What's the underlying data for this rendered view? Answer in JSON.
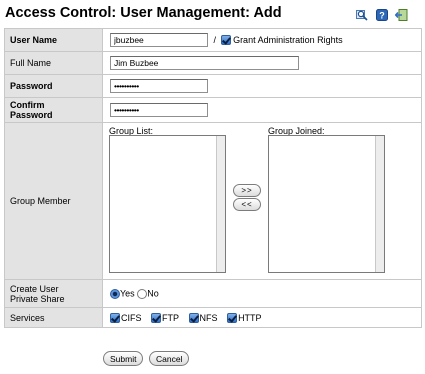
{
  "header": {
    "title": "Access Control: User Management: Add",
    "icons": [
      "search-icon",
      "help-icon",
      "exit-icon"
    ]
  },
  "form": {
    "user_name": {
      "label": "User Name",
      "value": "jbuzbee"
    },
    "separator": "/",
    "grant_admin": {
      "label": "Grant Administration Rights",
      "checked": true
    },
    "full_name": {
      "label": "Full Name",
      "value": "Jim Buzbee"
    },
    "password": {
      "label": "Password",
      "value": "••••••••••"
    },
    "confirm_password": {
      "label_line1": "Confirm",
      "label_line2": "Password",
      "value": "••••••••••"
    },
    "group_member": {
      "label": "Group Member",
      "group_list_label": "Group List:",
      "group_joined_label": "Group Joined:",
      "add_label": ">>",
      "remove_label": "<<"
    },
    "private_share": {
      "label_line1": "Create User",
      "label_line2": "Private Share",
      "yes_label": "Yes",
      "no_label": "No",
      "selected": "Yes"
    },
    "services": {
      "label": "Services",
      "items": [
        {
          "label": "CIFS",
          "checked": true
        },
        {
          "label": "FTP",
          "checked": true
        },
        {
          "label": "NFS",
          "checked": true
        },
        {
          "label": "HTTP",
          "checked": true
        }
      ]
    }
  },
  "actions": {
    "submit_label": "Submit",
    "cancel_label": "Cancel"
  },
  "colors": {
    "label_bg": "#e3e3e3",
    "border": "#c8c8c8",
    "checkbox": "#2e6fc7"
  }
}
